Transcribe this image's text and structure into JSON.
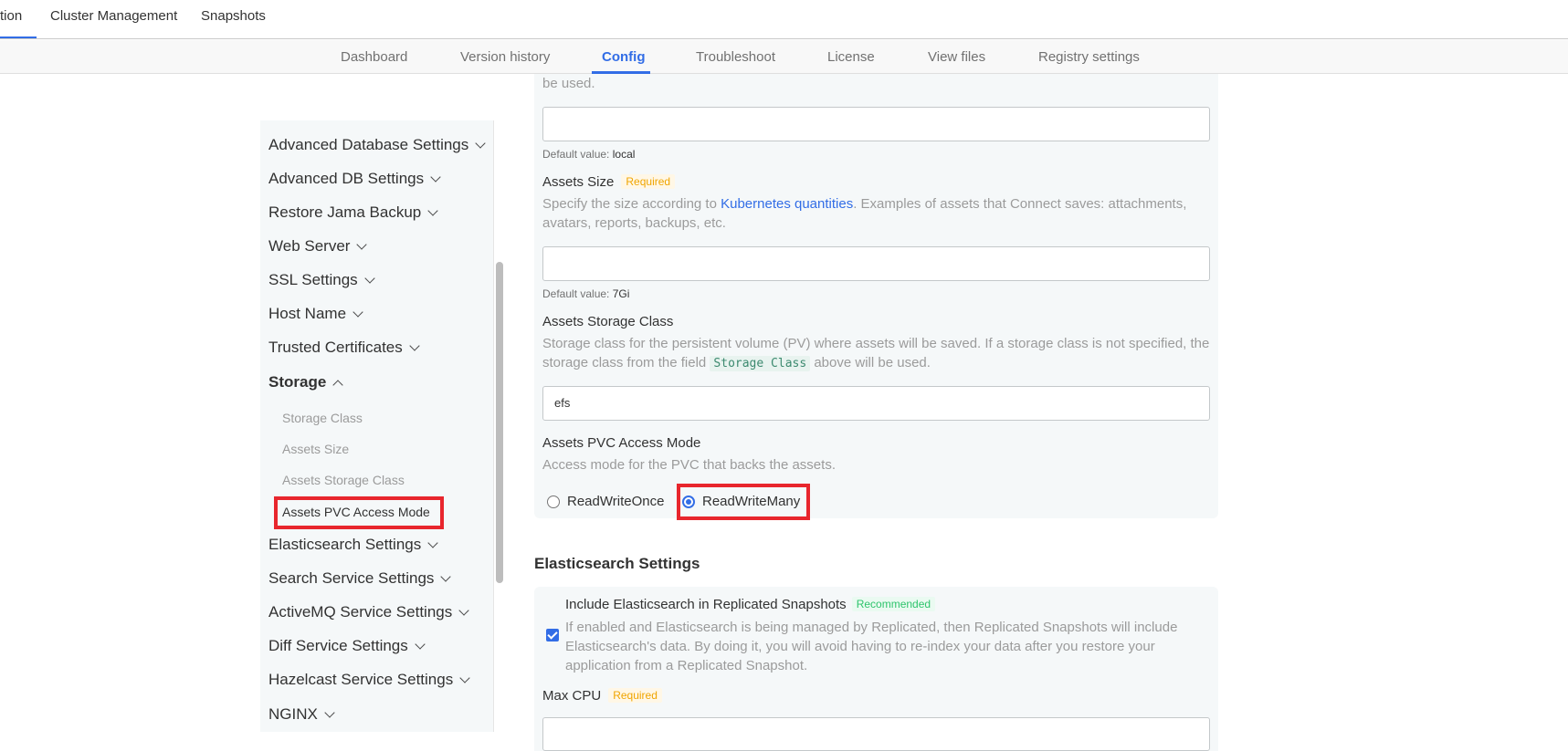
{
  "topnav": {
    "tabs": [
      {
        "label": "tion"
      },
      {
        "label": "Cluster Management"
      },
      {
        "label": "Snapshots"
      }
    ]
  },
  "subnav": {
    "tabs": [
      {
        "label": "Dashboard"
      },
      {
        "label": "Version history"
      },
      {
        "label": "Config",
        "active": true
      },
      {
        "label": "Troubleshoot"
      },
      {
        "label": "License"
      },
      {
        "label": "View files"
      },
      {
        "label": "Registry settings"
      }
    ]
  },
  "sidebar": {
    "items": [
      {
        "label": "Advanced Database Settings"
      },
      {
        "label": "Advanced DB Settings"
      },
      {
        "label": "Restore Jama Backup"
      },
      {
        "label": "Web Server"
      },
      {
        "label": "SSL Settings"
      },
      {
        "label": "Host Name"
      },
      {
        "label": "Trusted Certificates"
      },
      {
        "label": "Storage",
        "open": true
      },
      {
        "label": "Elasticsearch Settings"
      },
      {
        "label": "Search Service Settings"
      },
      {
        "label": "ActiveMQ Service Settings"
      },
      {
        "label": "Diff Service Settings"
      },
      {
        "label": "Hazelcast Service Settings"
      },
      {
        "label": "NGINX"
      }
    ],
    "storage_sub": [
      {
        "label": "Storage Class"
      },
      {
        "label": "Assets Size"
      },
      {
        "label": "Assets Storage Class"
      },
      {
        "label": "Assets PVC Access Mode"
      }
    ]
  },
  "main": {
    "top_desc_tail": "be used.",
    "storage_class": {
      "value": "",
      "default_label": "Default value:",
      "default_value": "local"
    },
    "assets_size": {
      "label": "Assets Size",
      "required": "Required",
      "desc_pre": "Specify the size according to ",
      "desc_link": "Kubernetes quantities",
      "desc_post": ". Examples of assets that Connect saves: attachments,",
      "desc_line2": "avatars, reports, backups, etc.",
      "value": "",
      "default_label": "Default value:",
      "default_value": "7Gi"
    },
    "assets_storage_class": {
      "label": "Assets Storage Class",
      "desc_line1": "Storage class for the persistent volume (PV) where assets will be saved. If a storage class is not specified, the",
      "desc_line2_pre": "storage class from the field ",
      "desc_code": "Storage Class",
      "desc_line2_post": " above will be used.",
      "value": "efs"
    },
    "assets_pvc": {
      "label": "Assets PVC Access Mode",
      "desc": "Access mode for the PVC that backs the assets.",
      "options": [
        {
          "label": "ReadWriteOnce",
          "checked": false
        },
        {
          "label": "ReadWriteMany",
          "checked": true
        }
      ]
    },
    "elasticsearch": {
      "title": "Elasticsearch Settings",
      "include_label": "Include Elasticsearch in Replicated Snapshots",
      "recommended": "Recommended",
      "include_desc1": "If enabled and Elasticsearch is being managed by Replicated, then Replicated Snapshots will include",
      "include_desc2": "Elasticsearch's data. By doing it, you will avoid having to re-index your data after you restore your",
      "include_desc3": "application from a Replicated Snapshot.",
      "max_cpu_label": "Max CPU",
      "max_cpu_required": "Required",
      "max_cpu_value": ""
    }
  },
  "colors": {
    "accent": "#326de6",
    "highlight_box": "#e8262d",
    "panel_bg": "#f5f8f9",
    "required": "#f0a500",
    "recommended": "#2ec46c"
  }
}
